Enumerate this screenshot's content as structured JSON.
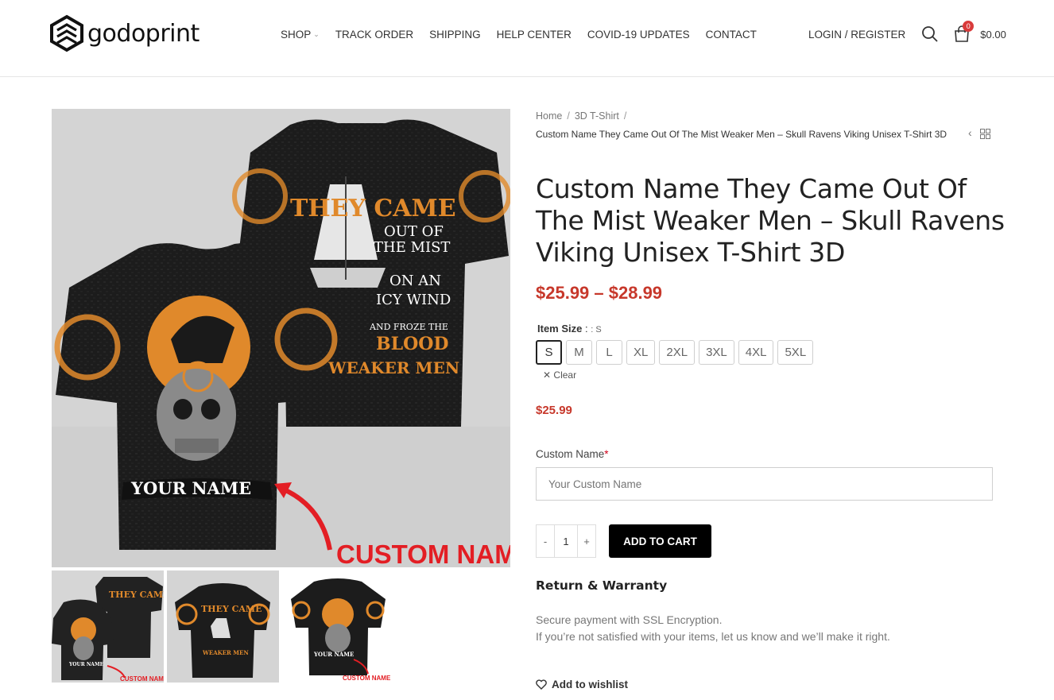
{
  "brand": {
    "logo_text": "godoprint"
  },
  "nav": {
    "items": [
      {
        "label": "SHOP",
        "has_dropdown": true
      },
      {
        "label": "TRACK ORDER"
      },
      {
        "label": "SHIPPING"
      },
      {
        "label": "HELP CENTER"
      },
      {
        "label": "COVID-19 UPDATES"
      },
      {
        "label": "CONTACT"
      }
    ]
  },
  "header": {
    "login_label": "LOGIN / REGISTER",
    "cart_count": "0",
    "cart_total": "$0.00"
  },
  "gallery": {
    "main": {
      "back_text_1": "THEY CAME",
      "back_text_2": "OUT OF",
      "back_text_3": "THE MIST",
      "back_text_4": "ON AN",
      "back_text_5": "ICY WIND",
      "back_text_6": "AND FROZE THE",
      "back_text_7": "BLOOD",
      "back_text_8": "WEAKER MEN",
      "front_name": "YOUR NAME",
      "custom_label": "CUSTOM NAME"
    },
    "thumbs": [
      {
        "name": "YOUR NAME",
        "custom": "CUSTOM NAME",
        "text": "THEY CAME"
      },
      {
        "text": "THEY CAME",
        "sub": "WEAKER MEN"
      },
      {
        "name": "YOUR NAME",
        "custom": "CUSTOM NAME"
      }
    ]
  },
  "breadcrumb": {
    "items": [
      "Home",
      "3D T-Shirt"
    ],
    "separator": "/",
    "current": "Custom Name They Came Out Of The Mist Weaker Men – Skull Ravens Viking Unisex T-Shirt 3D"
  },
  "product": {
    "title": "Custom Name They Came Out Of The Mist Weaker Men – Skull Ravens Viking Unisex T-Shirt 3D",
    "price_range": "$25.99 – $28.99",
    "size_label": "Item Size",
    "size_selected": ": S",
    "sizes": [
      "S",
      "M",
      "L",
      "XL",
      "2XL",
      "3XL",
      "4XL",
      "5XL"
    ],
    "selected_size": "S",
    "clear_label": "Clear",
    "variant_price": "$25.99",
    "custom_field_label": "Custom Name",
    "custom_field_required": "*",
    "custom_field_placeholder": "Your Custom Name",
    "qty_minus": "-",
    "qty_value": "1",
    "qty_plus": "+",
    "add_to_cart": "ADD TO CART",
    "return_title": "Return & Warranty",
    "return_line_1": "Secure payment with SSL Encryption.",
    "return_line_2": "If you’re not satisfied with your items, let us know and we’ll make it right.",
    "wishlist_label": "Add to wishlist"
  },
  "colors": {
    "accent_price": "#c7382b",
    "button_bg": "#000000",
    "cart_badge": "#d93b3b",
    "shirt_orange": "#e0892b"
  }
}
